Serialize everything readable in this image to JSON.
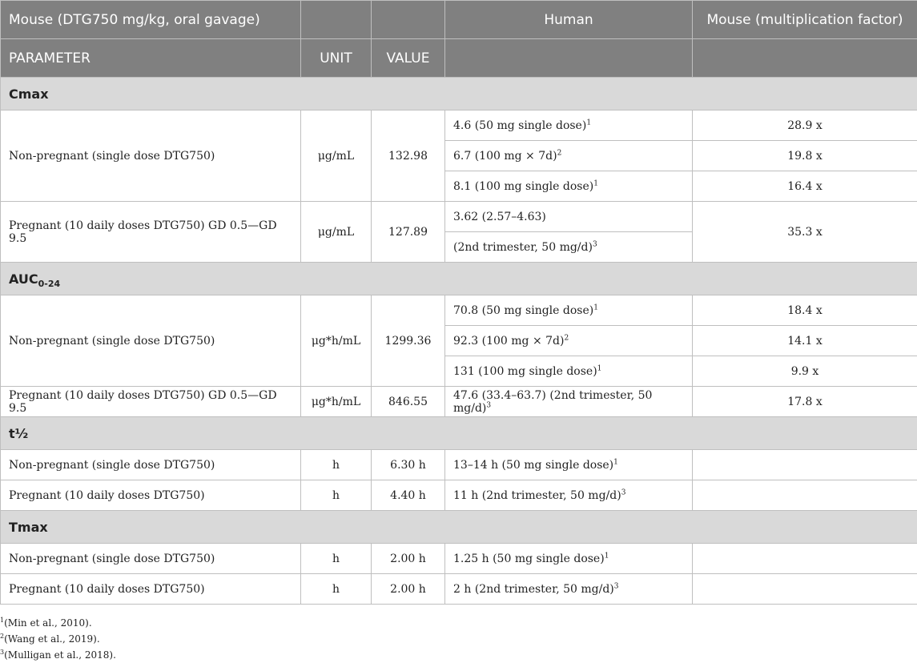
{
  "header": {
    "mouse_group": "Mouse (DTG750 mg/kg, oral gavage)",
    "human": "Human",
    "mouse_factor": "Mouse (multiplication factor)",
    "parameter": "PARAMETER",
    "unit": "UNIT",
    "value": "VALUE"
  },
  "cmax": {
    "title": "Cmax",
    "np_label": "Non-pregnant (single dose DTG750)",
    "np_unit": "μg/mL",
    "np_value": "132.98",
    "np_h1": "4.6 (50 mg single dose)",
    "np_h1_ref": "1",
    "np_f1": "28.9 x",
    "np_h2": "6.7 (100 mg × 7d)",
    "np_h2_ref": "2",
    "np_f2": "19.8 x",
    "np_h3": "8.1 (100 mg single dose)",
    "np_h3_ref": "1",
    "np_f3": "16.4 x",
    "p_label": "Pregnant (10 daily doses DTG750) GD 0.5—GD 9.5",
    "p_unit": "μg/mL",
    "p_value": "127.89",
    "p_h1": "3.62 (2.57–4.63)",
    "p_h2": "(2nd trimester, 50 mg/d)",
    "p_h2_ref": "3",
    "p_f": "35.3 x"
  },
  "auc": {
    "title_main": "AUC",
    "title_sub": "0-24",
    "np_label": "Non-pregnant (single dose DTG750)",
    "np_unit": "μg*h/mL",
    "np_value": "1299.36",
    "np_h1": "70.8 (50 mg single dose)",
    "np_h1_ref": "1",
    "np_f1": "18.4 x",
    "np_h2": "92.3 (100 mg × 7d)",
    "np_h2_ref": "2",
    "np_f2": "14.1 x",
    "np_h3": "131 (100 mg single dose)",
    "np_h3_ref": "1",
    "np_f3": "9.9 x",
    "p_label": "Pregnant (10 daily doses DTG750) GD 0.5—GD 9.5",
    "p_unit": "μg*h/mL",
    "p_value": "846.55",
    "p_h": "47.6 (33.4–63.7) (2nd trimester, 50 mg/d)",
    "p_h_ref": "3",
    "p_f": "17.8 x"
  },
  "thalf": {
    "title": "t½",
    "np_label": "Non-pregnant (single dose DTG750)",
    "np_unit": "h",
    "np_value": "6.30 h",
    "np_h": "13–14 h (50 mg single dose)",
    "np_h_ref": "1",
    "p_label": "Pregnant (10 daily doses DTG750)",
    "p_unit": "h",
    "p_value": "4.40 h",
    "p_h": "11 h (2nd trimester, 50 mg/d)",
    "p_h_ref": "3"
  },
  "tmax": {
    "title": "Tmax",
    "np_label": "Non-pregnant (single dose DTG750)",
    "np_unit": "h",
    "np_value": "2.00 h",
    "np_h": "1.25 h (50 mg single dose)",
    "np_h_ref": "1",
    "p_label": "Pregnant (10 daily doses DTG750)",
    "p_unit": "h",
    "p_value": "2.00 h",
    "p_h": "2 h (2nd trimester, 50 mg/d)",
    "p_h_ref": "3"
  },
  "footnotes": [
    {
      "ref": "1",
      "text": "(Min et al., 2010)."
    },
    {
      "ref": "2",
      "text": "(Wang et al., 2019)."
    },
    {
      "ref": "3",
      "text": "(Mulligan et al., 2018)."
    }
  ]
}
